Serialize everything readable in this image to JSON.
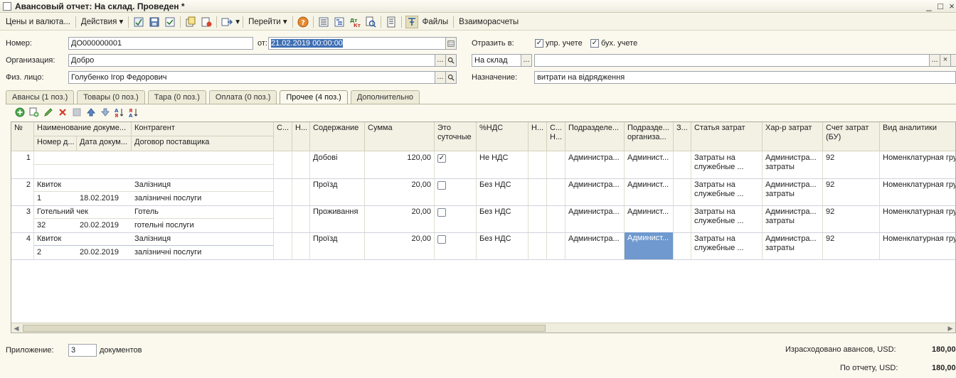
{
  "window": {
    "title": "Авансовый отчет: На склад. Проведен *"
  },
  "toolbar": {
    "prices_label": "Цены и валюта...",
    "actions_label": "Действия",
    "goto_label": "Перейти",
    "files_label": "Файлы",
    "settlements_label": "Взаиморасчеты"
  },
  "header": {
    "number_label": "Номер:",
    "number_value": "ДО000000001",
    "date_label": "от:",
    "date_value": "21.02.2019 00:00:00",
    "org_label": "Организация:",
    "org_value": "Добро",
    "person_label": "Физ. лицо:",
    "person_value": "Голубенко Ігор Федорович",
    "reflect_label": "Отразить в:",
    "mgmt_label": "упр. учете",
    "acct_label": "бух. учете",
    "warehouse_value": "На склад",
    "warehouse_dots": "...",
    "second_value": "",
    "purpose_label": "Назначение:",
    "purpose_value": "витрати на відрядження"
  },
  "tabs": [
    {
      "label": "Авансы (1 поз.)"
    },
    {
      "label": "Товары (0 поз.)"
    },
    {
      "label": "Тара (0 поз.)"
    },
    {
      "label": "Оплата (0 поз.)"
    },
    {
      "label": "Прочее (4 поз.)"
    },
    {
      "label": "Дополнительно"
    }
  ],
  "grid": {
    "headers": {
      "no": "№",
      "doc_name": "Наименование докуме...",
      "contractor": "Контрагент",
      "doc_number": "Номер д...",
      "doc_date": "Дата докум...",
      "contract": "Договор поставщика",
      "c1": "С...",
      "n1": "Н...",
      "content": "Содержание",
      "sum": "Сумма",
      "daily": "Это суточные",
      "vat": "%НДС",
      "n2": "Н...",
      "c2": "С... Н...",
      "dept": "Подразделе...",
      "dept_org": "Подразде... организа...",
      "z": "З...",
      "cost_item": "Статья затрат",
      "cost_kind": "Хар-р затрат",
      "account": "Счет затрат (БУ)",
      "analytics": "Вид аналитики"
    },
    "rows": [
      {
        "no": "1",
        "doc_name": "",
        "contractor": "",
        "doc_number": "",
        "doc_date": "",
        "contract": "",
        "content": "Добові",
        "sum": "120,00",
        "daily": true,
        "vat": "Не НДС",
        "dept": "Администра...",
        "dept_org": "Админист...",
        "cost_item": "Затраты на служебные ...",
        "cost_kind": "Администра... затраты",
        "account": "92",
        "analytics": "Номенклатурная гру"
      },
      {
        "no": "2",
        "doc_name": "Квиток",
        "contractor": "Залізниця",
        "doc_number": "1",
        "doc_date": "18.02.2019",
        "contract": "залізничні послуги",
        "content": "Проїзд",
        "sum": "20,00",
        "daily": false,
        "vat": "Без НДС",
        "dept": "Администра...",
        "dept_org": "Админист...",
        "cost_item": "Затраты на служебные ...",
        "cost_kind": "Администра... затраты",
        "account": "92",
        "analytics": "Номенклатурная гру"
      },
      {
        "no": "3",
        "doc_name": "Готельний чек",
        "contractor": "Готель",
        "doc_number": "32",
        "doc_date": "20.02.2019",
        "contract": "готельні послуги",
        "content": "Проживання",
        "sum": "20,00",
        "daily": false,
        "vat": "Без НДС",
        "dept": "Администра...",
        "dept_org": "Админист...",
        "cost_item": "Затраты на служебные ...",
        "cost_kind": "Администра... затраты",
        "account": "92",
        "analytics": "Номенклатурная гру"
      },
      {
        "no": "4",
        "doc_name": "Квиток",
        "contractor": "Залізниця",
        "doc_number": "2",
        "doc_date": "20.02.2019",
        "contract": "залізничні послуги",
        "content": "Проїзд",
        "sum": "20,00",
        "daily": false,
        "vat": "Без НДС",
        "dept": "Администра...",
        "dept_org": "Админист...",
        "cost_item": "Затраты на служебные ...",
        "cost_kind": "Администра... затраты",
        "account": "92",
        "analytics": "Номенклатурная гру"
      }
    ]
  },
  "footer": {
    "attachment_label": "Приложение:",
    "attachment_value": "3",
    "documents_label": "документов",
    "spent_label": "Израсходовано авансов, USD:",
    "spent_value": "180,00",
    "report_label": "По отчету, USD:",
    "report_value": "180,00"
  }
}
